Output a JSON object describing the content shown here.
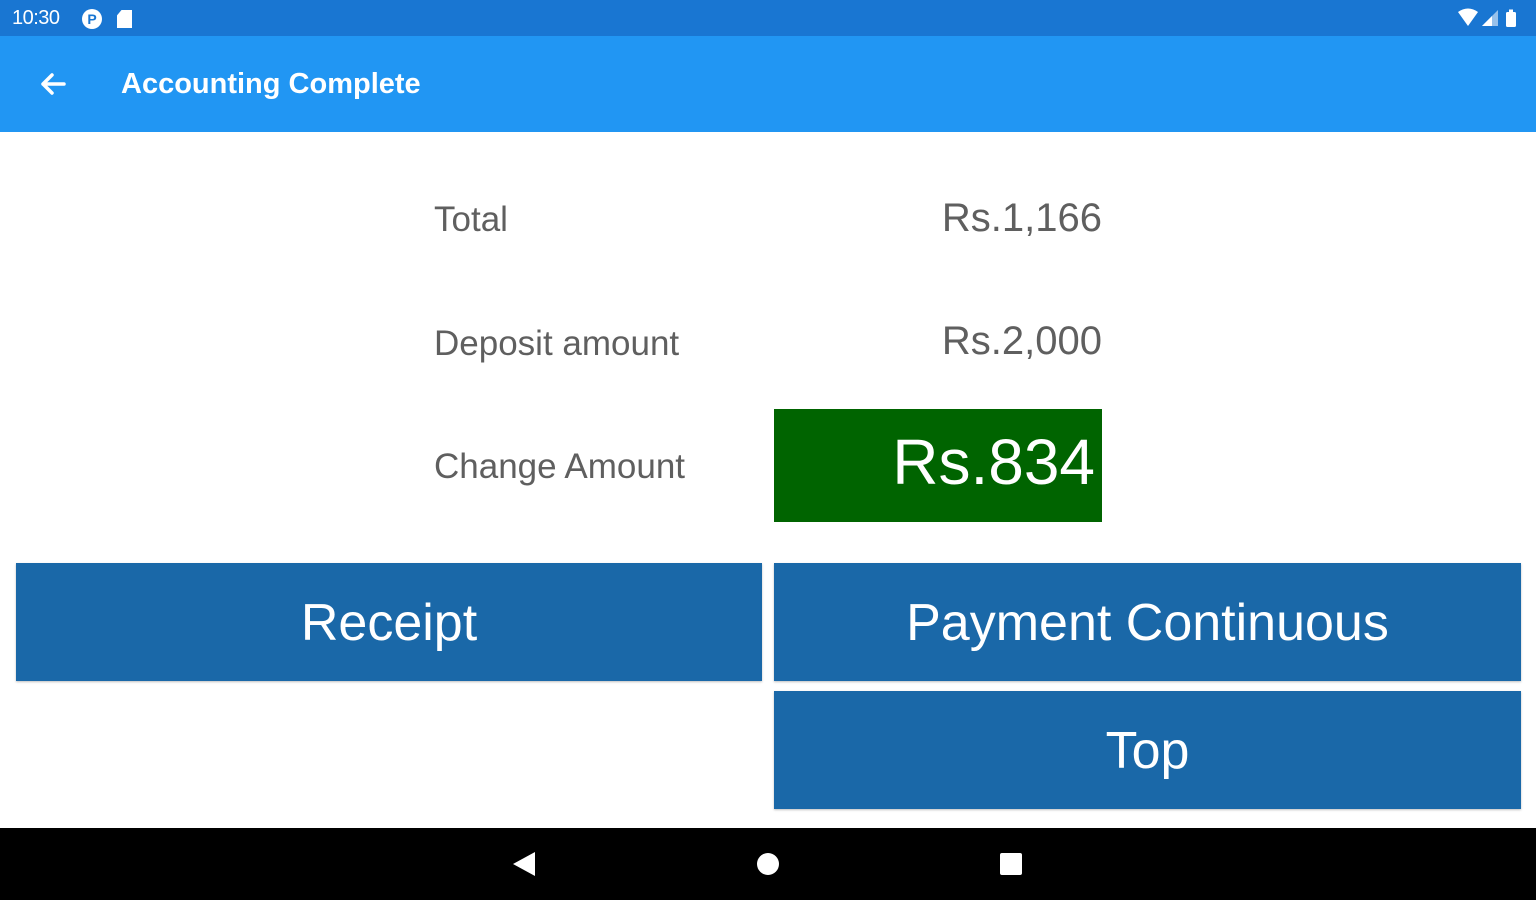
{
  "status_bar": {
    "time": "10:30",
    "notification_icon": "P",
    "icons": [
      "p-circle-icon",
      "sd-card-icon",
      "wifi-icon",
      "signal-icon",
      "battery-icon"
    ]
  },
  "app_bar": {
    "title": "Accounting Complete",
    "back_icon": "arrow-back-icon",
    "color": "#2196F3"
  },
  "summary": {
    "total_label": "Total",
    "total_value": "Rs.1,166",
    "deposit_label": "Deposit amount",
    "deposit_value": "Rs.2,000",
    "change_label": "Change Amount",
    "change_value": "Rs.834",
    "change_color": "#006400"
  },
  "buttons": {
    "receipt": "Receipt",
    "payment_continuous": "Payment Continuous",
    "top": "Top",
    "color": "#1A68A8"
  },
  "nav_bar": {
    "icons": [
      "nav-back-icon",
      "nav-home-icon",
      "nav-recents-icon"
    ]
  }
}
